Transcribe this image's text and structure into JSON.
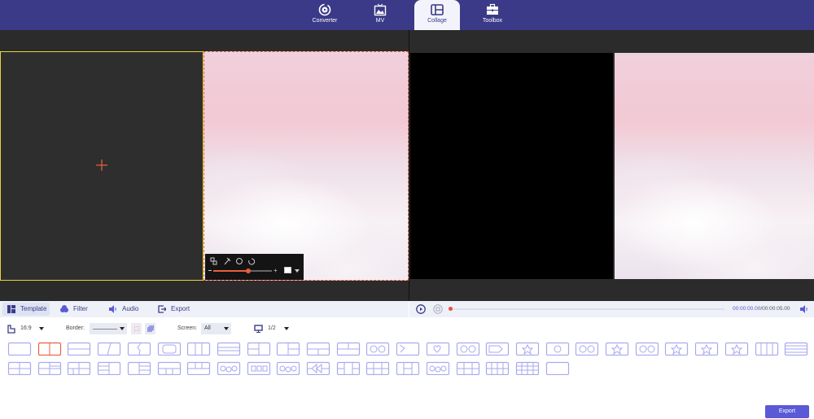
{
  "nav": [
    {
      "label": "Converter",
      "icon": "converter-icon"
    },
    {
      "label": "MV",
      "icon": "mv-icon"
    },
    {
      "label": "Collage",
      "icon": "collage-icon",
      "active": true
    },
    {
      "label": "Toolbox",
      "icon": "toolbox-icon"
    }
  ],
  "tabs": [
    {
      "label": "Template",
      "active": true
    },
    {
      "label": "Filter"
    },
    {
      "label": "Audio"
    },
    {
      "label": "Export"
    }
  ],
  "toolbar": {
    "aspect": "16:9",
    "border_label": "Border:",
    "screen_label": "Screen:",
    "screen_value": "All",
    "page": "1/2"
  },
  "player": {
    "current": "00:00:00.00",
    "total": "/00:00:05.00",
    "progress": 0
  },
  "edit_overlay": {
    "zoom_level": 0.6
  },
  "templates": {
    "row1_count": 27,
    "row2_count": 19,
    "selected": 1
  },
  "colors": {
    "accent": "#5a59d6",
    "nav_bg": "#3b3a88",
    "selected_template": "#e8603c",
    "template": "#a9a9ee"
  },
  "export_label": "Export"
}
